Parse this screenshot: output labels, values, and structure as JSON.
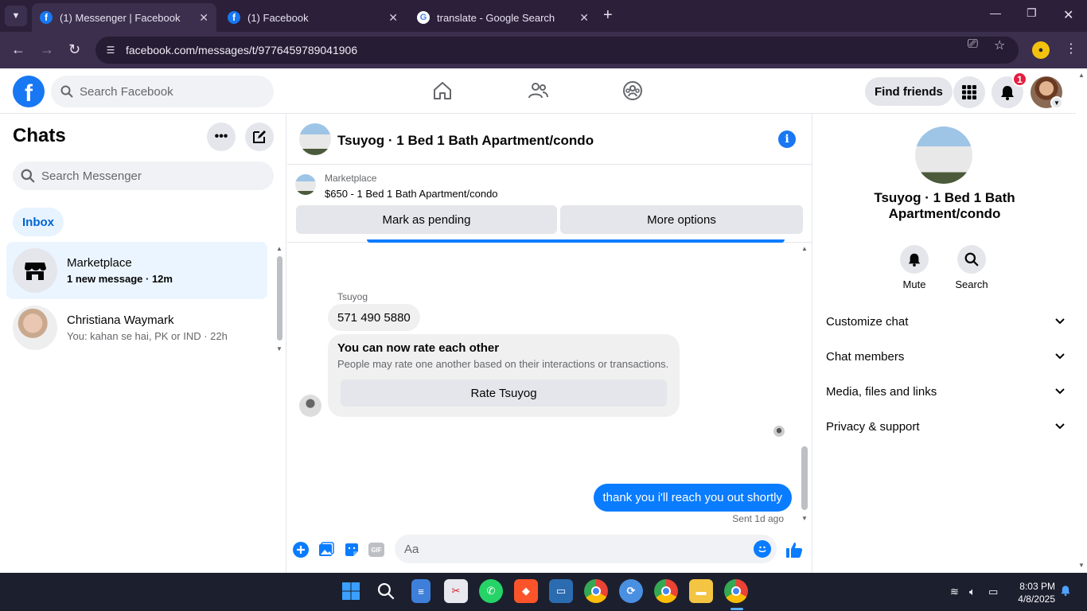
{
  "browser": {
    "tabs": [
      {
        "title": "(1) Messenger | Facebook",
        "active": true
      },
      {
        "title": "(1) Facebook",
        "active": false
      },
      {
        "title": "translate - Google Search",
        "active": false
      }
    ],
    "url": "facebook.com/messages/t/9776459789041906"
  },
  "header": {
    "search_placeholder": "Search Facebook",
    "find_friends": "Find friends",
    "notification_count": "1"
  },
  "sidebar": {
    "title": "Chats",
    "search_placeholder": "Search Messenger",
    "filter": "Inbox",
    "chats": [
      {
        "name": "Marketplace",
        "preview": "1 new message · 12m",
        "unread": true
      },
      {
        "name": "Christiana Waymark",
        "preview": "You: kahan se hai, PK or IND · 22h",
        "unread": false
      }
    ]
  },
  "conversation": {
    "title": "Tsuyog · 1 Bed 1 Bath Apartment/condo",
    "marketplace_label": "Marketplace",
    "listing": "$650 - 1 Bed 1 Bath Apartment/condo",
    "mark_pending": "Mark as pending",
    "more_options": "More options",
    "sender_name": "Tsuyog",
    "incoming_message": "571 490 5880",
    "rate_title": "You can now rate each other",
    "rate_subtitle": "People may rate one another based on their interactions or transactions.",
    "rate_button": "Rate Tsuyog",
    "outgoing_message": "thank you i'll reach you out shortly",
    "sent_status": "Sent 1d ago",
    "composer_placeholder": "Aa",
    "gif_label": "GIF"
  },
  "info_panel": {
    "name": "Tsuyog · 1 Bed 1 Bath Apartment/condo",
    "mute": "Mute",
    "search": "Search",
    "sections": [
      "Customize chat",
      "Chat members",
      "Media, files and links",
      "Privacy & support"
    ]
  },
  "taskbar": {
    "time": "8:03 PM",
    "date": "4/8/2025"
  },
  "colors": {
    "fb_blue": "#1877f2",
    "messenger_blue": "#0a7cff",
    "browser_frame": "#2b1f3a"
  }
}
